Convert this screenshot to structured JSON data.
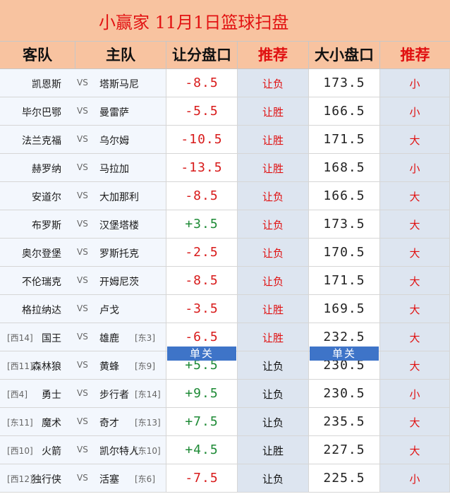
{
  "header": {
    "title": "小赢家 11月1日篮球扫盘",
    "columns": [
      "客队",
      "主队",
      "让分盘口",
      "推荐",
      "大小盘口",
      "推荐"
    ]
  },
  "badge_label": "单关",
  "rows": [
    {
      "away_rank": "",
      "away": "凯恩斯",
      "vs": "VS",
      "home": "塔斯马尼",
      "home_rank": "",
      "spread": "-8.5",
      "rec1": "让负",
      "total": "173.5",
      "rec2": "小"
    },
    {
      "away_rank": "",
      "away": "毕尔巴鄂",
      "vs": "VS",
      "home": "曼雷萨",
      "home_rank": "",
      "spread": "-5.5",
      "rec1": "让胜",
      "total": "166.5",
      "rec2": "小"
    },
    {
      "away_rank": "",
      "away": "法兰克福",
      "vs": "VS",
      "home": "乌尔姆",
      "home_rank": "",
      "spread": "-10.5",
      "rec1": "让胜",
      "total": "171.5",
      "rec2": "大"
    },
    {
      "away_rank": "",
      "away": "赫罗纳",
      "vs": "VS",
      "home": "马拉加",
      "home_rank": "",
      "spread": "-13.5",
      "rec1": "让胜",
      "total": "168.5",
      "rec2": "小"
    },
    {
      "away_rank": "",
      "away": "安道尔",
      "vs": "VS",
      "home": "大加那利",
      "home_rank": "",
      "spread": "-8.5",
      "rec1": "让负",
      "total": "166.5",
      "rec2": "大"
    },
    {
      "away_rank": "",
      "away": "布罗斯",
      "vs": "VS",
      "home": "汉堡塔楼",
      "home_rank": "",
      "spread": "+3.5",
      "rec1": "让负",
      "total": "173.5",
      "rec2": "大"
    },
    {
      "away_rank": "",
      "away": "奥尔登堡",
      "vs": "VS",
      "home": "罗斯托克",
      "home_rank": "",
      "spread": "-2.5",
      "rec1": "让负",
      "total": "170.5",
      "rec2": "大"
    },
    {
      "away_rank": "",
      "away": "不伦瑞克",
      "vs": "VS",
      "home": "开姆尼茨",
      "home_rank": "",
      "spread": "-8.5",
      "rec1": "让负",
      "total": "171.5",
      "rec2": "大"
    },
    {
      "away_rank": "",
      "away": "格拉纳达",
      "vs": "VS",
      "home": "卢戈",
      "home_rank": "",
      "spread": "-3.5",
      "rec1": "让胜",
      "total": "169.5",
      "rec2": "大"
    },
    {
      "away_rank": "[西14]",
      "away": "国王",
      "vs": "VS",
      "home": "雄鹿",
      "home_rank": "[东3]",
      "spread": "-6.5",
      "rec1": "让胜",
      "total": "232.5",
      "rec2": "大"
    },
    {
      "away_rank": "[西11]",
      "away": "森林狼",
      "vs": "VS",
      "home": "黄蜂",
      "home_rank": "[东9]",
      "spread": "+5.5",
      "rec1": "让负",
      "total": "230.5",
      "rec2": "大"
    },
    {
      "away_rank": "[西4]",
      "away": "勇士",
      "vs": "VS",
      "home": "步行者",
      "home_rank": "[东14]",
      "spread": "+9.5",
      "rec1": "让负",
      "total": "230.5",
      "rec2": "小"
    },
    {
      "away_rank": "[东11]",
      "away": "魔术",
      "vs": "VS",
      "home": "奇才",
      "home_rank": "[东13]",
      "spread": "+7.5",
      "rec1": "让负",
      "total": "235.5",
      "rec2": "大"
    },
    {
      "away_rank": "[西10]",
      "away": "火箭",
      "vs": "VS",
      "home": "凯尔特人",
      "home_rank": "[东10]",
      "spread": "+4.5",
      "rec1": "让胜",
      "total": "227.5",
      "rec2": "大"
    },
    {
      "away_rank": "[西12]",
      "away": "独行侠",
      "vs": "VS",
      "home": "活塞",
      "home_rank": "[东6]",
      "spread": "-7.5",
      "rec1": "让负",
      "total": "225.5",
      "rec2": "小"
    }
  ]
}
